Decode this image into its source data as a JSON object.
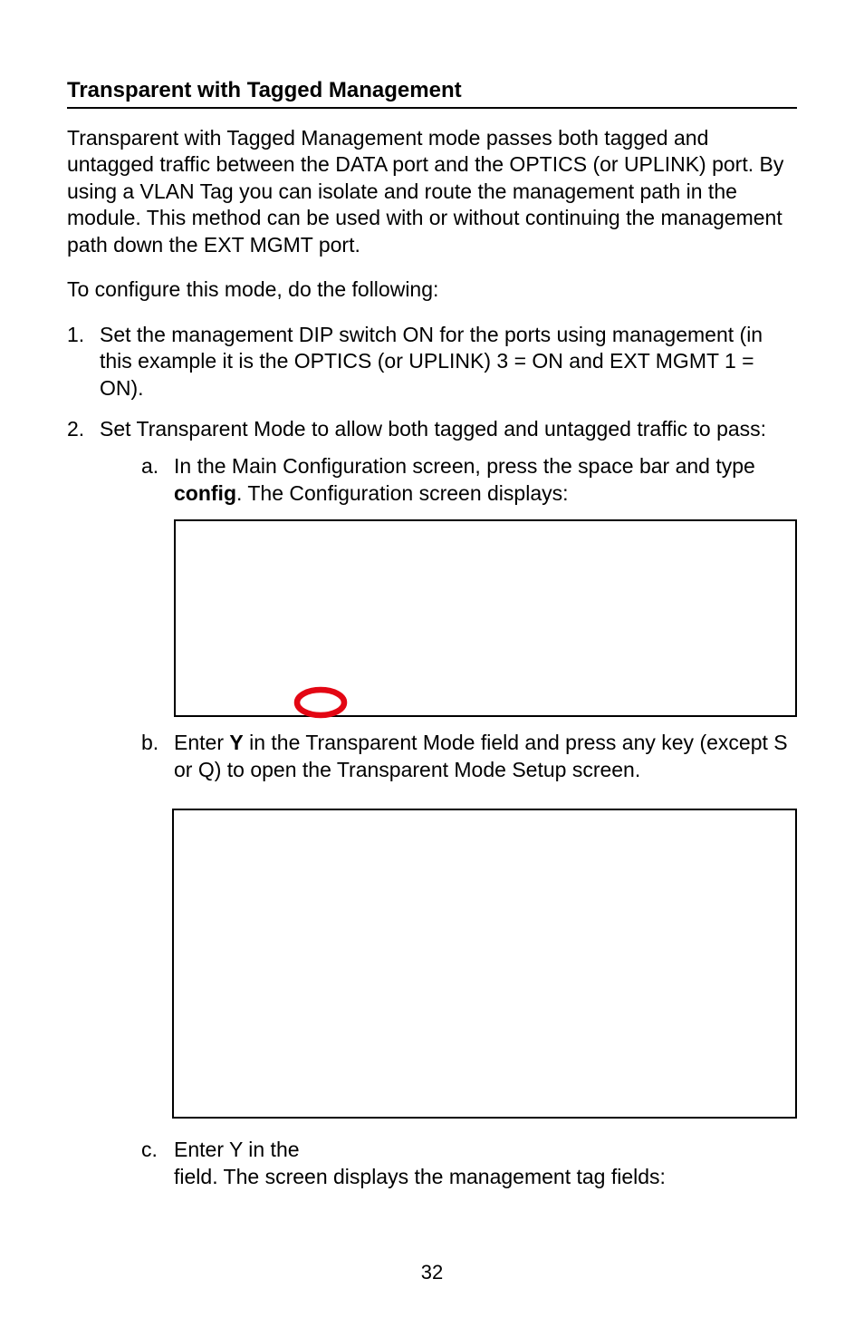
{
  "heading": "Transparent with Tagged Management",
  "intro": "Transparent with Tagged Management mode passes both tagged and untagged traffic between the DATA port and the OPTICS (or UPLINK) port.  By using a VLAN Tag you can isolate and route the management path in the module.  This method can be used with or without continuing the management path down the EXT MGMT port.",
  "lead": "To configure this mode, do the following:",
  "steps": {
    "one": {
      "num": "1.",
      "text": "Set the management DIP switch ON for the ports using management (in this example it is the OPTICS (or UPLINK) 3 = ON and EXT MGMT 1 = ON)."
    },
    "two": {
      "num": "2.",
      "text": "Set Transparent Mode to allow both tagged and untagged traffic to pass:",
      "a": {
        "num": "a.",
        "pre": "In the Main Configuration screen, press the space bar and type ",
        "bold": "config",
        "post": ".  The Configuration screen displays:"
      },
      "b": {
        "num": "b.",
        "pre": "Enter ",
        "bold": "Y",
        "post": " in the Transparent Mode field and press any key (except S or Q) to open the Transparent Mode Setup screen."
      },
      "c": {
        "num": "c.",
        "line1": "Enter Y in the",
        "line2": "field.  The screen displays the management tag fields:"
      }
    }
  },
  "page_number": "32"
}
